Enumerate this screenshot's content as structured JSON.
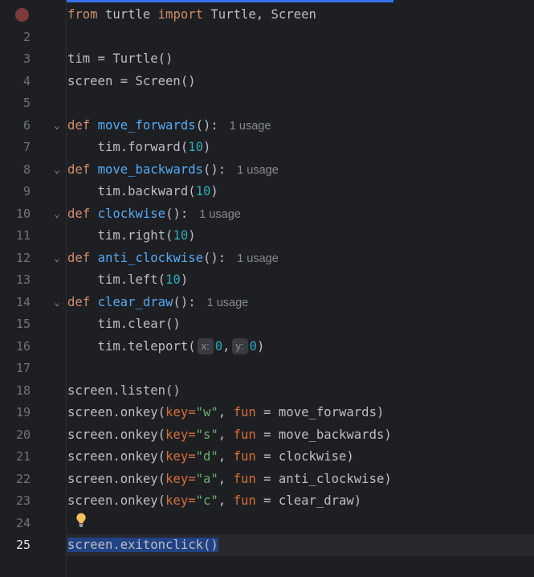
{
  "editor": {
    "current_line": 25,
    "gutter": {
      "line_numbers": [
        "",
        "2",
        "3",
        "4",
        "5",
        "6",
        "7",
        "8",
        "9",
        "10",
        "11",
        "12",
        "13",
        "14",
        "15",
        "16",
        "17",
        "18",
        "19",
        "20",
        "21",
        "22",
        "23",
        "24",
        "25"
      ]
    },
    "code": {
      "l1": {
        "t1": "from",
        "t2": " turtle ",
        "t3": "import",
        "t4": " Turtle, Screen"
      },
      "l3": "tim = Turtle()",
      "l4": "screen = Screen()",
      "l6": {
        "kw": "def",
        "name": "move_forwards",
        "rest": "():",
        "hint": "1 usage"
      },
      "l7": {
        "pre": "    tim.forward(",
        "num": "10",
        "post": ")"
      },
      "l8": {
        "kw": "def",
        "name": "move_backwards",
        "rest": "():",
        "hint": "1 usage"
      },
      "l9": {
        "pre": "    tim.backward(",
        "num": "10",
        "post": ")"
      },
      "l10": {
        "kw": "def",
        "name": "clockwise",
        "rest": "():",
        "hint": "1 usage"
      },
      "l11": {
        "pre": "    tim.right(",
        "num": "10",
        "post": ")"
      },
      "l12": {
        "kw": "def",
        "name": "anti_clockwise",
        "rest": "():",
        "hint": "1 usage"
      },
      "l13": {
        "pre": "    tim.left(",
        "num": "10",
        "post": ")"
      },
      "l14": {
        "kw": "def",
        "name": "clear_draw",
        "rest": "():",
        "hint": "1 usage"
      },
      "l15": "    tim.clear()",
      "l16": {
        "pre": "    tim.teleport(",
        "x_hint": "x:",
        "x_val": "0",
        "sep": ",",
        "y_hint": "y:",
        "y_val": "0",
        "post": ")"
      },
      "l18": "screen.listen()",
      "l19": {
        "pre": "screen.onkey(",
        "k": "key",
        "eq": "=",
        "val": "\"w\"",
        "comma": ", ",
        "fun": "fun",
        "rest": " = move_forwards)"
      },
      "l20": {
        "pre": "screen.onkey(",
        "k": "key",
        "eq": "=",
        "val": "\"s\"",
        "comma": ", ",
        "fun": "fun",
        "rest": " = move_backwards)"
      },
      "l21": {
        "pre": "screen.onkey(",
        "k": "key",
        "eq": "=",
        "val": "\"d\"",
        "comma": ", ",
        "fun": "fun",
        "rest": " = clockwise)"
      },
      "l22": {
        "pre": "screen.onkey(",
        "k": "key",
        "eq": "=",
        "val": "\"a\"",
        "comma": ", ",
        "fun": "fun",
        "rest": " = anti_clockwise)"
      },
      "l23": {
        "pre": "screen.onkey(",
        "k": "key",
        "eq": "=",
        "val": "\"c\"",
        "comma": ", ",
        "fun": "fun",
        "rest": " = clear_draw)"
      },
      "l25": "screen.exitonclick()"
    },
    "icons": {
      "breakpoint": "breakpoint-icon",
      "fold": "chevron-down-icon",
      "intention": "lightbulb-icon"
    },
    "colors": {
      "background": "#1e1f22",
      "keyword": "#cf8e6d",
      "function": "#56a8f5",
      "number": "#2aacb8",
      "string": "#6aab73",
      "named_param": "#d66e3c",
      "selection": "#214283",
      "breakpoint": "#7d3b3b"
    }
  }
}
